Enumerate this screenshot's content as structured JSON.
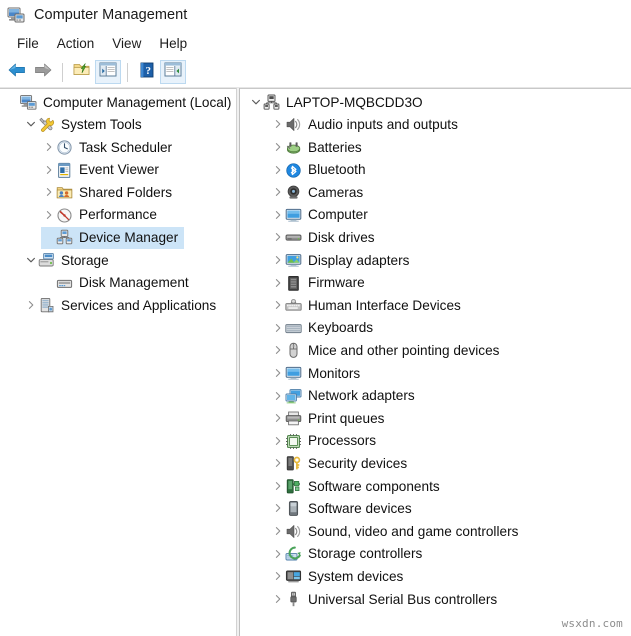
{
  "window": {
    "title": "Computer Management",
    "icon": "computer-management-icon"
  },
  "menu": {
    "items": [
      {
        "label": "File",
        "name": "menu-file"
      },
      {
        "label": "Action",
        "name": "menu-action"
      },
      {
        "label": "View",
        "name": "menu-view"
      },
      {
        "label": "Help",
        "name": "menu-help"
      }
    ]
  },
  "toolbar": {
    "buttons": [
      {
        "name": "back-button",
        "icon": "back-arrow-icon",
        "framed": false
      },
      {
        "name": "forward-button",
        "icon": "forward-arrow-icon",
        "framed": false
      },
      {
        "name": "up-one-level-button",
        "icon": "folder-up-icon",
        "framed": false
      },
      {
        "name": "show-hide-console-tree-button",
        "icon": "console-tree-icon",
        "framed": true
      },
      {
        "name": "help-button",
        "icon": "help-question-icon",
        "framed": false
      },
      {
        "name": "show-hide-action-pane-button",
        "icon": "action-pane-icon",
        "framed": true
      }
    ]
  },
  "left_pane": {
    "name": "console-tree",
    "rows": [
      {
        "label": "Computer Management (Local)",
        "indent": 0,
        "twisty": "none",
        "icon": "computer-management-icon",
        "selected": false
      },
      {
        "label": "System Tools",
        "indent": 1,
        "twisty": "expanded",
        "icon": "system-tools-icon",
        "selected": false
      },
      {
        "label": "Task Scheduler",
        "indent": 2,
        "twisty": "collapsed",
        "icon": "task-scheduler-icon",
        "selected": false
      },
      {
        "label": "Event Viewer",
        "indent": 2,
        "twisty": "collapsed",
        "icon": "event-viewer-icon",
        "selected": false
      },
      {
        "label": "Shared Folders",
        "indent": 2,
        "twisty": "collapsed",
        "icon": "shared-folders-icon",
        "selected": false
      },
      {
        "label": "Performance",
        "indent": 2,
        "twisty": "collapsed",
        "icon": "performance-icon",
        "selected": false
      },
      {
        "label": "Device Manager",
        "indent": 2,
        "twisty": "none",
        "icon": "device-manager-icon",
        "selected": true
      },
      {
        "label": "Storage",
        "indent": 1,
        "twisty": "expanded",
        "icon": "storage-icon",
        "selected": false
      },
      {
        "label": "Disk Management",
        "indent": 2,
        "twisty": "none",
        "icon": "disk-management-icon",
        "selected": false
      },
      {
        "label": "Services and Applications",
        "indent": 1,
        "twisty": "collapsed",
        "icon": "services-applications-icon",
        "selected": false
      }
    ]
  },
  "right_pane": {
    "name": "device-manager-tree",
    "rows": [
      {
        "label": "LAPTOP-MQBCDD3O",
        "indent": 0,
        "twisty": "expanded",
        "icon": "computer-node-icon"
      },
      {
        "label": "Audio inputs and outputs",
        "indent": 1,
        "twisty": "collapsed",
        "icon": "speaker-icon"
      },
      {
        "label": "Batteries",
        "indent": 1,
        "twisty": "collapsed",
        "icon": "battery-icon"
      },
      {
        "label": "Bluetooth",
        "indent": 1,
        "twisty": "collapsed",
        "icon": "bluetooth-icon"
      },
      {
        "label": "Cameras",
        "indent": 1,
        "twisty": "collapsed",
        "icon": "camera-icon"
      },
      {
        "label": "Computer",
        "indent": 1,
        "twisty": "collapsed",
        "icon": "monitor-icon"
      },
      {
        "label": "Disk drives",
        "indent": 1,
        "twisty": "collapsed",
        "icon": "disk-drive-icon"
      },
      {
        "label": "Display adapters",
        "indent": 1,
        "twisty": "collapsed",
        "icon": "display-adapter-icon"
      },
      {
        "label": "Firmware",
        "indent": 1,
        "twisty": "collapsed",
        "icon": "firmware-chip-icon"
      },
      {
        "label": "Human Interface Devices",
        "indent": 1,
        "twisty": "collapsed",
        "icon": "hid-icon"
      },
      {
        "label": "Keyboards",
        "indent": 1,
        "twisty": "collapsed",
        "icon": "keyboard-icon"
      },
      {
        "label": "Mice and other pointing devices",
        "indent": 1,
        "twisty": "collapsed",
        "icon": "mouse-icon"
      },
      {
        "label": "Monitors",
        "indent": 1,
        "twisty": "collapsed",
        "icon": "monitor-icon"
      },
      {
        "label": "Network adapters",
        "indent": 1,
        "twisty": "collapsed",
        "icon": "network-adapter-icon"
      },
      {
        "label": "Print queues",
        "indent": 1,
        "twisty": "collapsed",
        "icon": "printer-icon"
      },
      {
        "label": "Processors",
        "indent": 1,
        "twisty": "collapsed",
        "icon": "processor-icon"
      },
      {
        "label": "Security devices",
        "indent": 1,
        "twisty": "collapsed",
        "icon": "security-device-icon"
      },
      {
        "label": "Software components",
        "indent": 1,
        "twisty": "collapsed",
        "icon": "software-component-icon"
      },
      {
        "label": "Software devices",
        "indent": 1,
        "twisty": "collapsed",
        "icon": "software-device-icon"
      },
      {
        "label": "Sound, video and game controllers",
        "indent": 1,
        "twisty": "collapsed",
        "icon": "sound-video-icon"
      },
      {
        "label": "Storage controllers",
        "indent": 1,
        "twisty": "collapsed",
        "icon": "storage-controller-icon"
      },
      {
        "label": "System devices",
        "indent": 1,
        "twisty": "collapsed",
        "icon": "system-device-icon"
      },
      {
        "label": "Universal Serial Bus controllers",
        "indent": 1,
        "twisty": "collapsed",
        "icon": "usb-icon"
      }
    ]
  },
  "watermark": {
    "text": "wsxdn.com"
  },
  "colors": {
    "selection": "#cce4f7",
    "toolbar_frame": "#e8f2fb",
    "accent_blue": "#0078d7"
  }
}
